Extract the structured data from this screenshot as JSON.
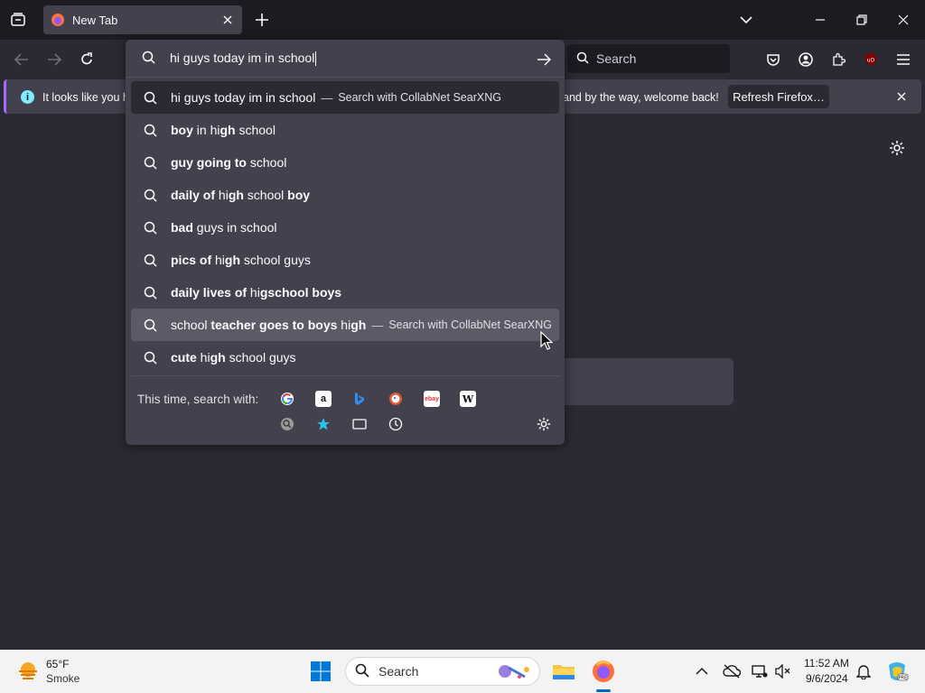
{
  "browser": {
    "tab_title": "New Tab",
    "search_placeholder": "Search"
  },
  "notification": {
    "message_left": "It looks like you ha",
    "message_right": "and by the way, welcome back!",
    "refresh_label": "Refresh Firefox…"
  },
  "urlbar": {
    "value": "hi guys today im in school",
    "one_off_label": "This time, search with:",
    "results": [
      {
        "parts": [
          {
            "t": "hi guys today im in school",
            "b": false
          }
        ],
        "engine": "Search with CollabNet SearXNG",
        "state": "selected"
      },
      {
        "parts": [
          {
            "t": "boy",
            "b": true
          },
          {
            "t": " in hi",
            "b": false
          },
          {
            "t": "gh",
            "b": true
          },
          {
            "t": " school",
            "b": false
          }
        ],
        "engine": "",
        "state": ""
      },
      {
        "parts": [
          {
            "t": "guy going to",
            "b": true
          },
          {
            "t": " school",
            "b": false
          }
        ],
        "engine": "",
        "state": ""
      },
      {
        "parts": [
          {
            "t": "daily of",
            "b": true
          },
          {
            "t": " hi",
            "b": false
          },
          {
            "t": "gh",
            "b": true
          },
          {
            "t": " school ",
            "b": false
          },
          {
            "t": "boy",
            "b": true
          }
        ],
        "engine": "",
        "state": ""
      },
      {
        "parts": [
          {
            "t": "bad",
            "b": true
          },
          {
            "t": " guys in school",
            "b": false
          }
        ],
        "engine": "",
        "state": ""
      },
      {
        "parts": [
          {
            "t": "pics of",
            "b": true
          },
          {
            "t": " hi",
            "b": false
          },
          {
            "t": "gh",
            "b": true
          },
          {
            "t": " school guys",
            "b": false
          }
        ],
        "engine": "",
        "state": ""
      },
      {
        "parts": [
          {
            "t": "daily lives of",
            "b": true
          },
          {
            "t": " hi",
            "b": false
          },
          {
            "t": "gschool boys",
            "b": true
          }
        ],
        "engine": "",
        "state": ""
      },
      {
        "parts": [
          {
            "t": "school ",
            "b": false
          },
          {
            "t": "teacher goes to boys",
            "b": true
          },
          {
            "t": " hi",
            "b": false
          },
          {
            "t": "gh",
            "b": true
          }
        ],
        "engine": "Search with CollabNet SearXNG",
        "state": "hover"
      },
      {
        "parts": [
          {
            "t": "cute",
            "b": true
          },
          {
            "t": " hi",
            "b": false
          },
          {
            "t": "gh",
            "b": true
          },
          {
            "t": " school guys",
            "b": false
          }
        ],
        "engine": "",
        "state": ""
      }
    ],
    "engines": [
      "google-icon",
      "amazon-icon",
      "bing-icon",
      "duckduckgo-icon",
      "ebay-icon",
      "wikipedia-icon",
      "searxng-icon",
      "bookmarks-icon",
      "tabs-icon",
      "history-icon"
    ]
  },
  "taskbar": {
    "temperature": "65°F",
    "weather": "Smoke",
    "search_label": "Search",
    "time": "11:52 AM",
    "date": "9/6/2024"
  },
  "colors": {
    "accent": "#a36cff",
    "info": "#80ebff",
    "firefox_orange": "#ff7139"
  }
}
